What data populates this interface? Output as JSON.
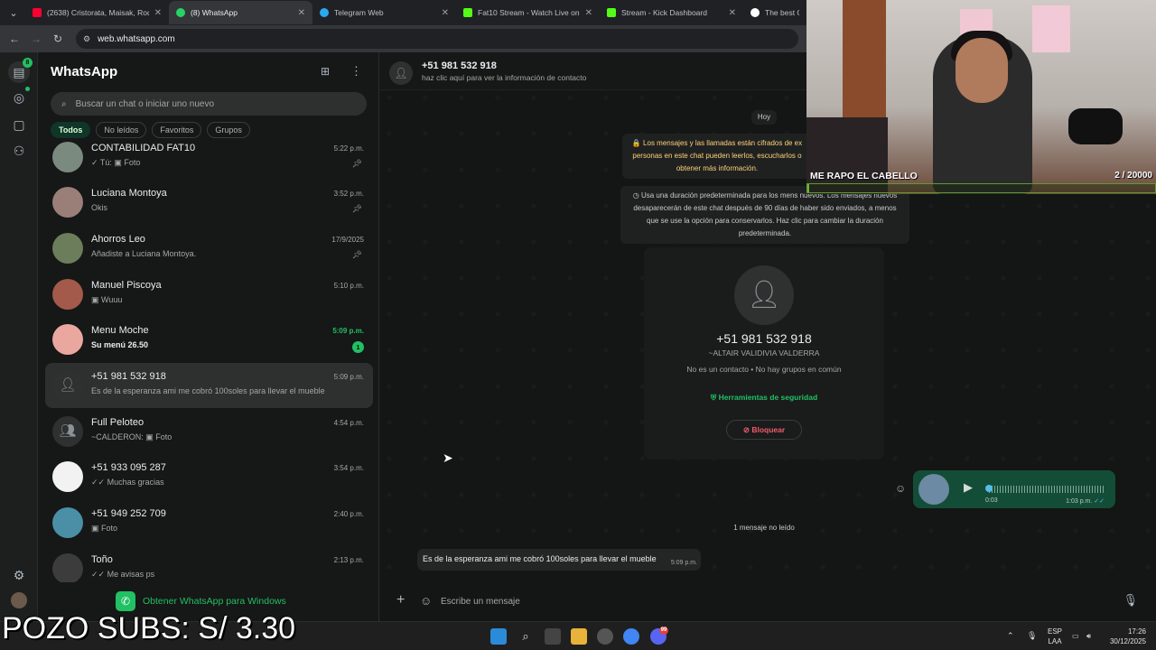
{
  "browser": {
    "tabs": [
      {
        "title": "(2638) Cristorata, Maisak, Rodri",
        "color": "#ff0033"
      },
      {
        "title": "(8) WhatsApp",
        "color": "#25d366"
      },
      {
        "title": "Telegram Web",
        "color": "#2aabee"
      },
      {
        "title": "Fat10 Stream - Watch Live on K",
        "color": "#53fc18"
      },
      {
        "title": "Stream - Kick Dashboard",
        "color": "#53fc18"
      },
      {
        "title": "The best ChatB",
        "color": "#ffffff"
      }
    ],
    "url": "web.whatsapp.com"
  },
  "rail": {
    "chats_badge": "8"
  },
  "sidebar": {
    "title": "WhatsApp",
    "search_placeholder": "Buscar un chat o iniciar uno nuevo",
    "filters": [
      "Todos",
      "No leídos",
      "Favoritos",
      "Grupos"
    ],
    "chats": [
      {
        "name": "CONTABILIDAD FAT10",
        "preview": "✓ Tú: ▣ Foto",
        "time": "5:22 p.m.",
        "pinned": true
      },
      {
        "name": "Luciana Montoya",
        "preview": "Okis",
        "time": "3:52 p.m.",
        "pinned": true
      },
      {
        "name": "Ahorros Leo",
        "preview": "Añadiste a Luciana Montoya.",
        "time": "17/9/2025",
        "pinned": true
      },
      {
        "name": "Manuel Piscoya",
        "preview": "▣ Wuuu",
        "time": "5:10 p.m."
      },
      {
        "name": "Menu Moche",
        "preview": "Su menú 26.50",
        "time": "5:09 p.m.",
        "unread": "1"
      },
      {
        "name": "+51 981 532 918",
        "preview": "Es de la esperanza ami me cobró 100soles para llevar el mueble",
        "time": "5:09 p.m."
      },
      {
        "name": "Full Peloteo",
        "preview": "~CALDERON: ▣ Foto",
        "time": "4:54 p.m."
      },
      {
        "name": "+51 933 095 287",
        "preview": "✓✓ Muchas gracias",
        "time": "3:54 p.m."
      },
      {
        "name": "+51 949 252 709",
        "preview": "▣ Foto",
        "time": "2:40 p.m."
      },
      {
        "name": "Toño",
        "preview": "✓✓ Me avisas ps",
        "time": "2:13 p.m."
      }
    ],
    "get_windows": "Obtener WhatsApp para Windows"
  },
  "chat": {
    "header_number": "+51 981 532 918",
    "header_sub": "haz clic aquí para ver la información de contacto",
    "day": "Hoy",
    "encryption_notice": "🔒 Los mensajes y las llamadas están cifrados de ex personas en este chat pueden leerlos, escucharlos o obtener más información.",
    "disappearing_notice": "◷ Usa una duración predeterminada para los mens nuevos. Los mensajes nuevos desaparecerán de este chat después de 90 días de haber sido enviados, a menos que se use la opción para conservarlos. Haz clic para cambiar la duración predeterminada.",
    "card": {
      "number": "+51 981 532 918",
      "alias": "~ALTAIR VALIDIVIA VALDERRA",
      "info": "No es un contacto • No hay grupos en común",
      "safety": "Herramientas de seguridad",
      "block": "Bloquear"
    },
    "voice": {
      "duration": "0:03",
      "time": "1:03 p.m."
    },
    "unread_marker": "1 mensaje no leído",
    "incoming": {
      "text": "Es de la esperanza ami me cobró 100soles para llevar el mueble",
      "time": "5:09 p.m."
    },
    "composer_placeholder": "Escribe un mensaje"
  },
  "overlay": {
    "goal_title": "ME RAPO EL CABELLO",
    "goal_count": "2  / 20000",
    "goal_progress": 0.0001,
    "pozo": "POZO SUBS: S/ 3.30"
  },
  "taskbar": {
    "lang": "ESP",
    "lang2": "LAA",
    "time": "17:26",
    "date": "30/12/2025",
    "discord_badge": "99"
  }
}
